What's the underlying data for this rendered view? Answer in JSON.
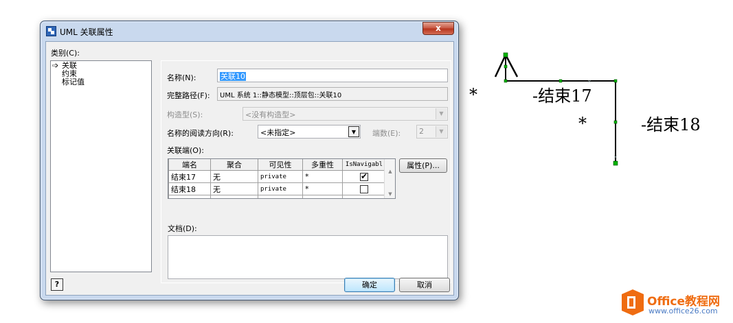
{
  "window": {
    "title": "UML 关联属性",
    "close_glyph": "x"
  },
  "category": {
    "label": "类别(C):",
    "items": [
      "关联",
      "约束",
      "标记值"
    ],
    "selected_index": 0
  },
  "form": {
    "name_label": "名称(N):",
    "name_value": "关联10",
    "fullpath_label": "完整路径(F):",
    "fullpath_value": "UML 系统 1::静态模型::顶层包::关联10",
    "stereotype_label": "构造型(S):",
    "stereotype_value": "<没有构造型>",
    "reading_dir_label": "名称的阅读方向(R):",
    "reading_dir_value": "<未指定>",
    "ends_count_label": "端数(E):",
    "ends_count_value": "2",
    "association_ends_label": "关联端(O):",
    "documentation_label": "文档(D):"
  },
  "ends_table": {
    "columns": [
      "端名",
      "聚合",
      "可见性",
      "多重性",
      "IsNavigabl"
    ],
    "rows": [
      {
        "name": "结束17",
        "aggregation": "无",
        "visibility": "private",
        "multiplicity": "*",
        "navigable": true
      },
      {
        "name": "结束18",
        "aggregation": "无",
        "visibility": "private",
        "multiplicity": "*",
        "navigable": false
      }
    ]
  },
  "buttons": {
    "properties": "属性(P)...",
    "ok": "确定",
    "cancel": "取消",
    "help": "?"
  },
  "diagram": {
    "star_1": "*",
    "end_1_label": "-结束17",
    "star_2": "*",
    "end_2_label": "-结束18",
    "connector_color": "#00b400"
  },
  "watermark": {
    "brand": "Office教程网",
    "url": "www.office26.com",
    "brand_color": "#ef6c11"
  }
}
